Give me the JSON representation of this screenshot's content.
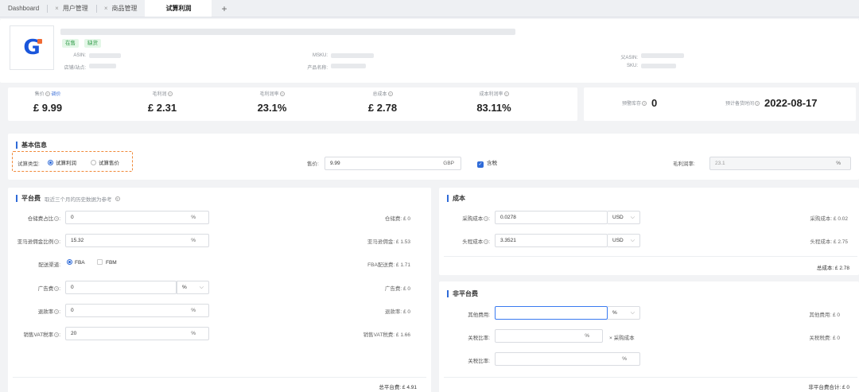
{
  "tabs": [
    {
      "label": "Dashboard"
    },
    {
      "label": "用户管理"
    },
    {
      "label": "商品管理"
    },
    {
      "label": "试算利润",
      "active": true
    }
  ],
  "product": {
    "logo_letter": "G",
    "tags": [
      "在售",
      "缺货"
    ],
    "meta": {
      "asin": "ASIN:",
      "shop": "店铺/站点:",
      "msku": "MSKU:",
      "product_name": "产品名称:",
      "parent_asin": "父ASIN:",
      "sku": "SKU:"
    }
  },
  "stats": {
    "price_label": "售价",
    "price_link": "调价",
    "price": "£ 9.99",
    "gross_profit_label": "毛利润",
    "gross_profit": "£ 2.31",
    "gross_margin_label": "毛利润率",
    "gross_margin": "23.1%",
    "total_cost_label": "总成本",
    "total_cost": "£ 2.78",
    "cost_margin_label": "成本利润率",
    "cost_margin": "83.11%",
    "stock_alert_label": "预警库存",
    "stock_alert": "0",
    "restock_date_label": "预计备货时间",
    "restock_date": "2022-08-17"
  },
  "basic": {
    "title": "基本信息",
    "calc_type_label": "试算类型:",
    "opt_profit": "试算利润",
    "opt_price": "试算售价",
    "price_label": "售价:",
    "price_value": "9.99",
    "price_unit": "GBP",
    "tax_label": "含税",
    "margin_label": "毛利润率:",
    "margin_value": "23.1",
    "margin_unit": "%"
  },
  "platform": {
    "title": "平台费",
    "subtitle": "取近三个月的历史数据为参考",
    "rows": [
      {
        "label": "仓储费占比",
        "value": "0",
        "unit": "%",
        "result": "仓储费: £ 0"
      },
      {
        "label": "亚马逊佣金比例",
        "value": "15.32",
        "unit": "%",
        "result": "亚马逊佣金: £ 1.53"
      },
      {
        "label": "广告费",
        "value": "0",
        "unit": "%",
        "result": "广告费: £ 0"
      },
      {
        "label": "退款率",
        "value": "0",
        "unit": "%",
        "result": "退款率: £ 0"
      },
      {
        "label": "销售VAT税率",
        "value": "20",
        "unit": "%",
        "result": "销售VAT税费: £ 1.66"
      }
    ],
    "delivery_label": "配送渠道:",
    "fba": "FBA",
    "fbm": "FBM",
    "fba_fee": "FBA配送费: £ 1.71",
    "total": "总平台费: £ 4.91"
  },
  "cost": {
    "title": "成本",
    "rows": [
      {
        "label": "采购成本",
        "value": "0.0278",
        "currency": "USD",
        "result": "采购成本: £ 0.02"
      },
      {
        "label": "头程成本",
        "value": "3.3521",
        "currency": "USD",
        "result": "头程成本: £ 2.75"
      }
    ],
    "total": "总成本: £ 2.78"
  },
  "nonplatform": {
    "title": "非平台费",
    "other_label": "其他费用:",
    "other_unit": "%",
    "other_result": "其他费用: £ 0",
    "customs_label": "关税比率:",
    "customs_unit": "%",
    "customs_note": "× 采购成本",
    "customs_result": "关税税费: £ 0",
    "duty_label": "关税比率:",
    "duty_unit": "%",
    "total": "非平台费合计: £ 0"
  }
}
